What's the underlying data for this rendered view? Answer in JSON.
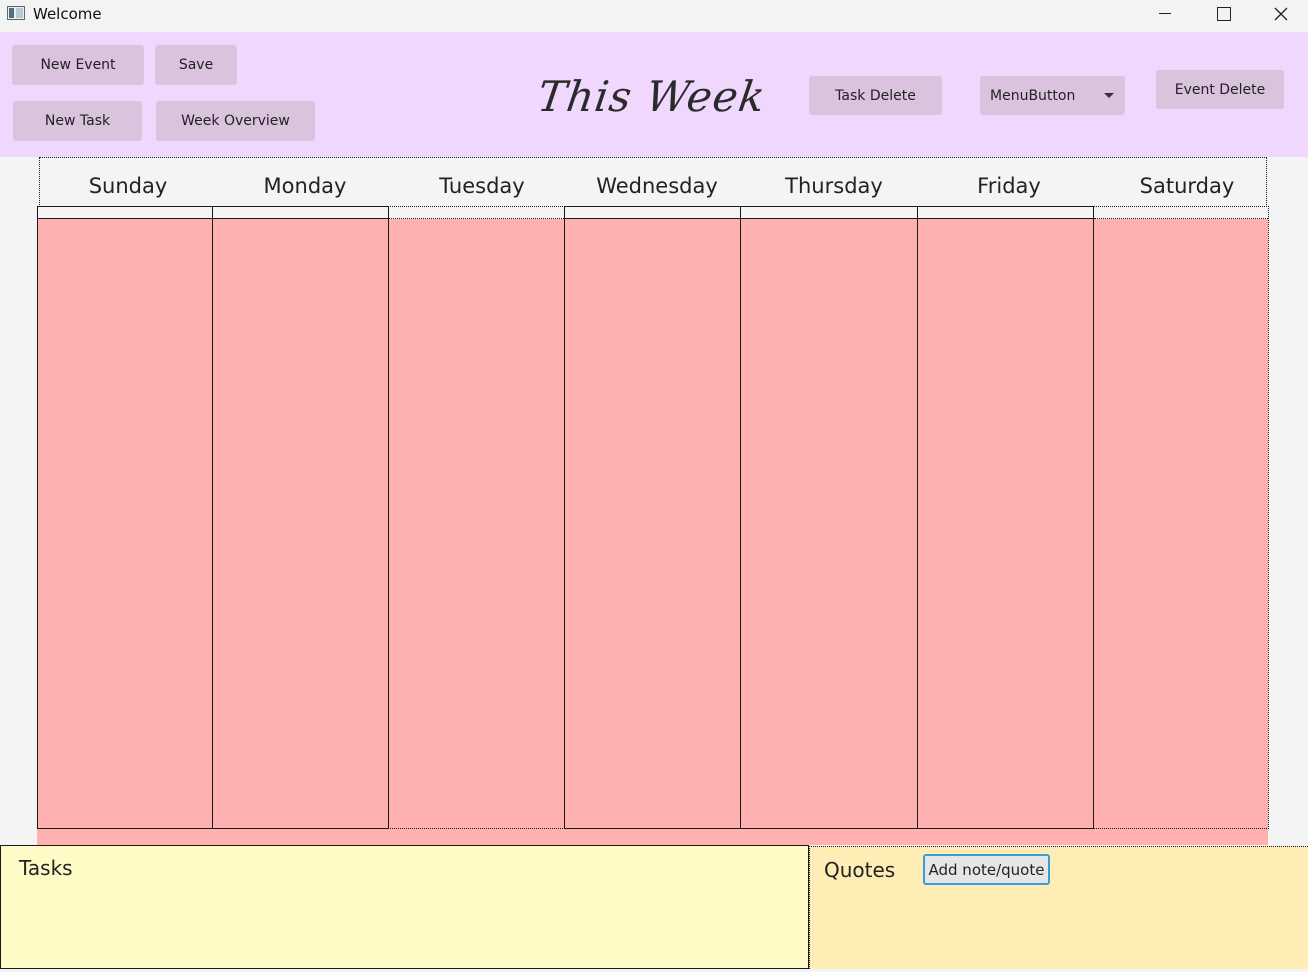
{
  "window": {
    "title": "Welcome",
    "controls": [
      "minimize-icon",
      "maximize-icon",
      "close-icon"
    ]
  },
  "toolbar": {
    "new_event": "New Event",
    "save": "Save",
    "new_task": "New Task",
    "week_overview": "Week Overview",
    "task_delete": "Task Delete",
    "menu_button": "MenuButton",
    "event_delete": "Event Delete"
  },
  "header": {
    "title": "This Week"
  },
  "week": {
    "days": [
      "Sunday",
      "Monday",
      "Tuesday",
      "Wednesday",
      "Thursday",
      "Friday",
      "Saturday"
    ]
  },
  "panels": {
    "tasks_label": "Tasks",
    "quotes_label": "Quotes",
    "add_note": "Add note/quote"
  },
  "colors": {
    "header_bg": "#efd7fd",
    "button_bg": "#d9c3dd",
    "day_column_bg": "#ffb0b1",
    "tasks_bg": "#fffbc7",
    "quotes_bg": "#ffedb6",
    "focus_border": "#3a9fd6"
  }
}
